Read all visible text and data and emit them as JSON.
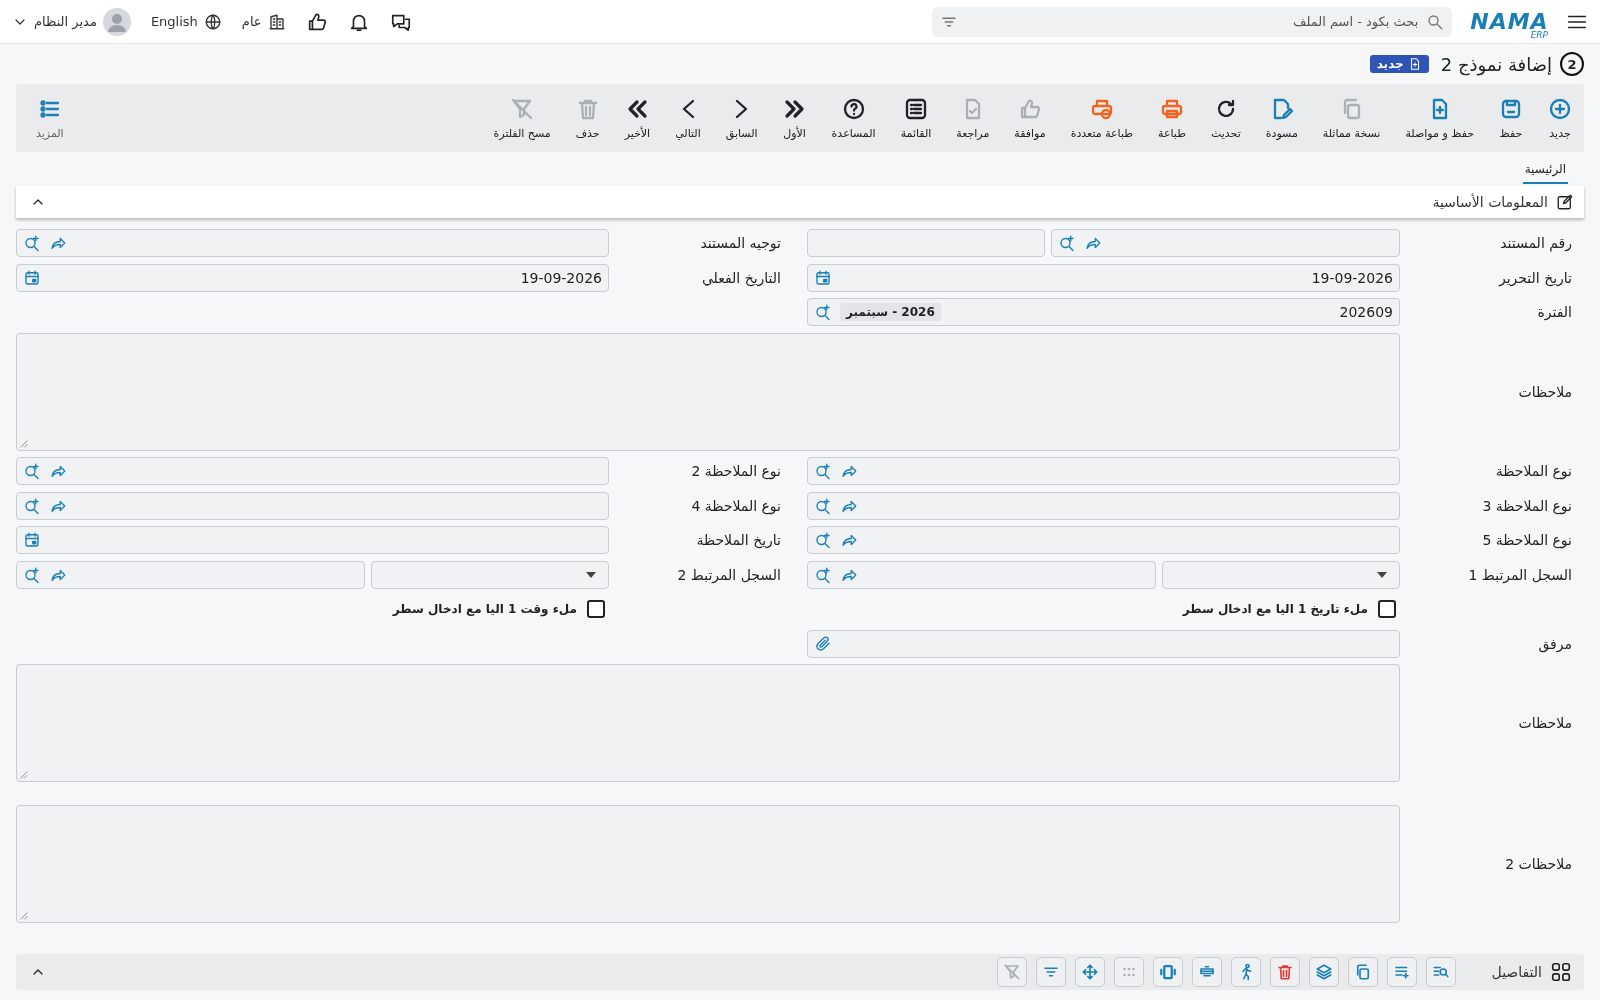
{
  "topbar": {
    "logo": "NAMA",
    "logo_sub": "ERP",
    "search": {
      "placeholder": "بحث بكود - اسم الملف"
    },
    "branch": "عام",
    "language": "English",
    "user": "مدير النظام"
  },
  "page": {
    "step": "2",
    "title": "إضافة نموذج 2",
    "badge": "جديد"
  },
  "toolbar": [
    {
      "label": "جديد",
      "color": "#1a7fb5"
    },
    {
      "label": "حفظ",
      "color": "#1a7fb5"
    },
    {
      "label": "حفظ و مواصلة",
      "color": "#1a7fb5"
    },
    {
      "label": "نسخة مماثلة",
      "color": "#a9b0b8"
    },
    {
      "label": "مسودة",
      "color": "#1a7fb5"
    },
    {
      "label": "تحديث",
      "color": "#1f2328"
    },
    {
      "label": "طباعة",
      "color": "#f0641e"
    },
    {
      "label": "طباعة متعددة",
      "color": "#f0641e"
    },
    {
      "label": "موافقة",
      "color": "#a9b0b8"
    },
    {
      "label": "مراجعة",
      "color": "#a9b0b8"
    },
    {
      "label": "القائمة",
      "color": "#1f2328"
    },
    {
      "label": "المساعدة",
      "color": "#1f2328"
    },
    {
      "label": "الأول",
      "color": "#1f2328"
    },
    {
      "label": "السابق",
      "color": "#1f2328"
    },
    {
      "label": "التالي",
      "color": "#1f2328"
    },
    {
      "label": "الأخير",
      "color": "#1f2328"
    },
    {
      "label": "حذف",
      "color": "#a9b0b8"
    },
    {
      "label": "مسح الفلترة",
      "color": "#a9b0b8"
    }
  ],
  "more": {
    "label": "المزيد"
  },
  "tabs": [
    {
      "label": "الرئيسية",
      "selected": true
    }
  ],
  "section": {
    "title": "المعلومات الأساسية",
    "expanded": true
  },
  "rows": [
    {
      "fields": [
        {
          "label": "رقم المستند",
          "kind": "lookup-split"
        },
        {
          "label": "توجيه المستند",
          "kind": "lookup"
        }
      ]
    },
    {
      "fields": [
        {
          "label": "تاريخ التحرير",
          "kind": "date",
          "value": "19-09-2026"
        },
        {
          "label": "التاريخ الفعلي",
          "kind": "date",
          "value": "19-09-2026"
        }
      ]
    },
    {
      "fields": [
        {
          "label": "الفترة",
          "kind": "period",
          "value": "202609",
          "chip": "2026 - سبتمبر"
        }
      ]
    },
    {
      "fields": [
        {
          "label": "ملاحظات",
          "kind": "textarea"
        }
      ]
    },
    {
      "fields": [
        {
          "label": "نوع الملاحظة",
          "kind": "lookup"
        },
        {
          "label": "نوع الملاحظة 2",
          "kind": "lookup"
        }
      ]
    },
    {
      "fields": [
        {
          "label": "نوع الملاحظة 3",
          "kind": "lookup"
        },
        {
          "label": "نوع الملاحظة 4",
          "kind": "lookup"
        }
      ]
    },
    {
      "fields": [
        {
          "label": "نوع الملاحظة 5",
          "kind": "lookup"
        },
        {
          "label": "تاريخ الملاحظة",
          "kind": "date"
        }
      ]
    },
    {
      "fields": [
        {
          "label": "السجل المرتبط 1",
          "kind": "select-lookup"
        },
        {
          "label": "السجل المرتبط 2",
          "kind": "select-lookup"
        }
      ]
    },
    {
      "fields": [
        {
          "label": "ملء تاريخ 1 اليا مع ادخال سطر",
          "kind": "checkbox",
          "checked": false
        },
        {
          "label": "ملء وقت 1 اليا مع ادخال سطر",
          "kind": "checkbox",
          "checked": false
        }
      ]
    },
    {
      "fields": [
        {
          "label": "مرفق",
          "kind": "attach"
        }
      ]
    },
    {
      "fields": [
        {
          "label": "ملاحظات",
          "kind": "textarea"
        }
      ]
    },
    {
      "fields": [
        {
          "label": "ملاحظات 2",
          "kind": "textarea"
        }
      ]
    }
  ],
  "details": {
    "title": "التفاصيل",
    "expanded": false,
    "tools": [
      {
        "color": "#a9b0b8"
      },
      {
        "color": "#1a7fb5"
      },
      {
        "color": "#1a7fb5"
      },
      {
        "color": "#a9b0b8"
      },
      {
        "color": "#1a7fb5"
      },
      {
        "color": "#1a7fb5"
      },
      {
        "color": "#1a7fb5"
      },
      {
        "color": "#e53935"
      },
      {
        "color": "#1a7fb5"
      },
      {
        "color": "#1a7fb5"
      },
      {
        "color": "#1a7fb5"
      },
      {
        "color": "#1a7fb5"
      }
    ]
  }
}
